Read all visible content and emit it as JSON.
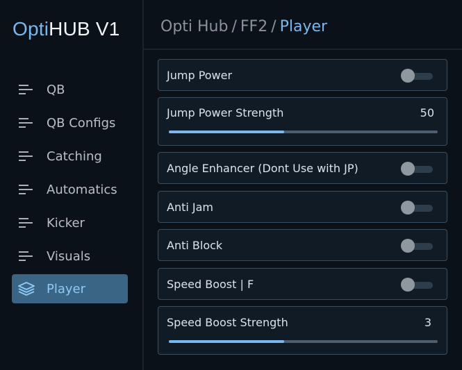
{
  "brand": {
    "accent": "Opti",
    "rest": "HUB V1"
  },
  "breadcrumb": {
    "part1": "Opti Hub",
    "sep": "/",
    "part2": "FF2",
    "current": "Player"
  },
  "sidebar": {
    "items": [
      {
        "label": "QB",
        "icon": "list-icon"
      },
      {
        "label": "QB Configs",
        "icon": "list-icon"
      },
      {
        "label": "Catching",
        "icon": "list-icon"
      },
      {
        "label": "Automatics",
        "icon": "list-icon"
      },
      {
        "label": "Kicker",
        "icon": "list-icon"
      },
      {
        "label": "Visuals",
        "icon": "list-icon"
      },
      {
        "label": "Player",
        "icon": "layers-icon",
        "active": true
      }
    ]
  },
  "settings": {
    "jump_power": {
      "label": "Jump Power",
      "enabled": false
    },
    "jump_power_strength": {
      "label": "Jump Power Strength",
      "value": "50",
      "fill": 0.43
    },
    "angle_enhancer": {
      "label": "Angle Enhancer (Dont Use with JP)",
      "enabled": false
    },
    "anti_jam": {
      "label": "Anti Jam",
      "enabled": false
    },
    "anti_block": {
      "label": "Anti Block",
      "enabled": false
    },
    "speed_boost": {
      "label": "Speed Boost | F",
      "enabled": false
    },
    "speed_boost_strength": {
      "label": "Speed Boost Strength",
      "value": "3",
      "fill": 0.43
    }
  },
  "colors": {
    "accent": "#78b8ee",
    "active_bg": "#3a6584",
    "background": "#0b1119",
    "card_border": "#3c4e5e"
  }
}
